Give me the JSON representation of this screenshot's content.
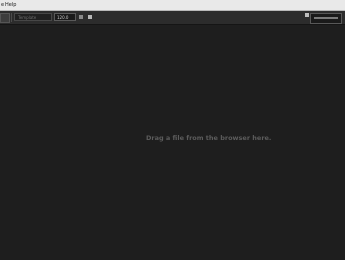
{
  "menu": {
    "items": [
      {
        "label": "e"
      },
      {
        "label": "Help"
      }
    ]
  },
  "toolbar": {
    "template_placeholder": "Template",
    "bpm_value": "120.0"
  },
  "main": {
    "hint": "Drag a file from the browser here."
  },
  "icons": [
    "play-icon",
    "stop-icon",
    "settings-icon"
  ],
  "colors": {
    "background": "#1e1e1e",
    "toolbar": "#2c2c2c",
    "menubar": "#e9e9e9",
    "hint_text": "#5c5c5c"
  }
}
